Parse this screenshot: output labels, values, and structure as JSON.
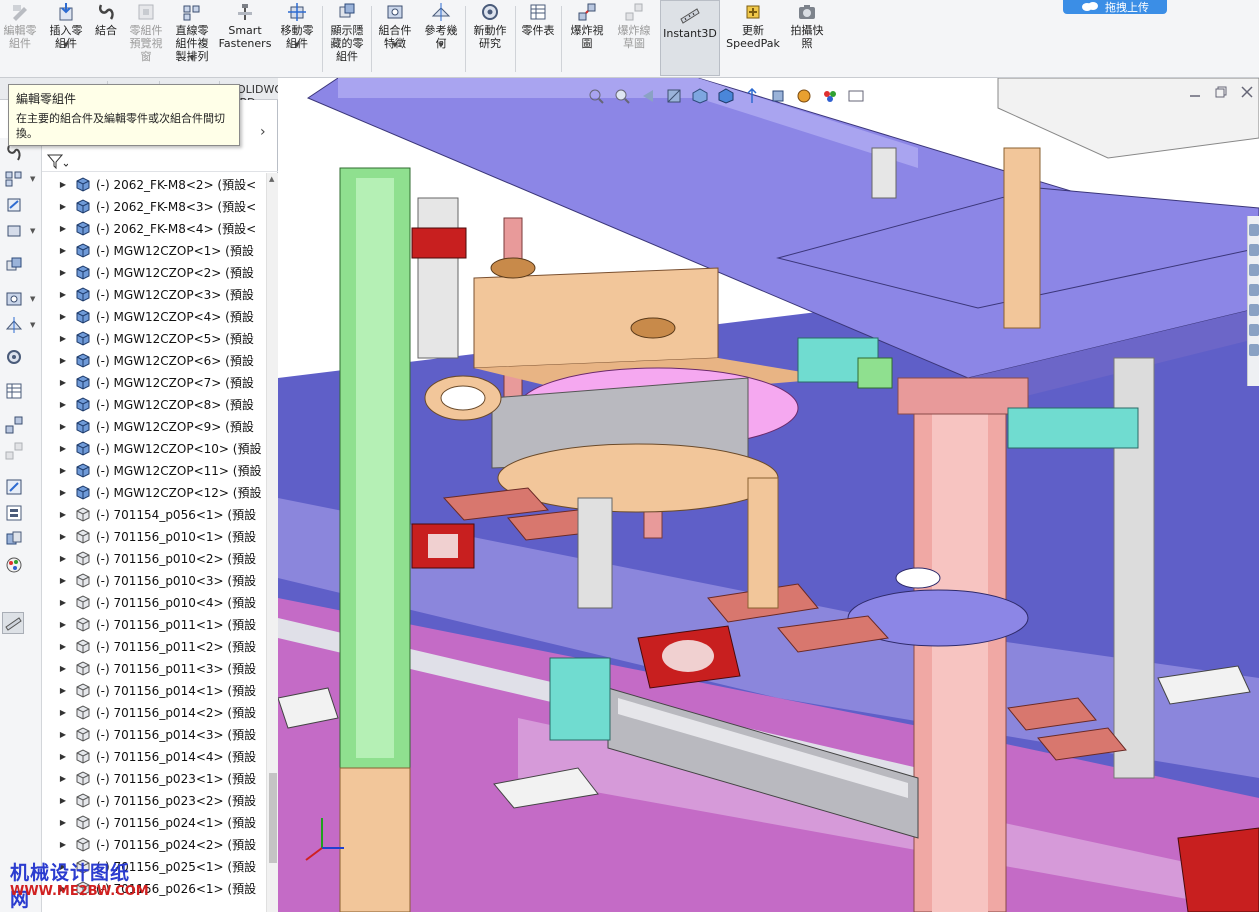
{
  "ribbon": {
    "buttons": [
      {
        "label": "編輯零\n組件",
        "icon": "edit-component-icon",
        "disabled": true
      },
      {
        "label": "插入零\n組件",
        "icon": "insert-component-icon",
        "disabled": false
      },
      {
        "label": "結合",
        "icon": "mate-icon",
        "disabled": false
      },
      {
        "label": "零組件\n預覽視\n窗",
        "icon": "component-preview-icon",
        "disabled": true
      },
      {
        "label": "直線零\n組件複\n製排列",
        "icon": "linear-pattern-icon",
        "disabled": false
      },
      {
        "label": "Smart\nFasteners",
        "icon": "smart-fasteners-icon",
        "disabled": false
      },
      {
        "label": "移動零\n組件",
        "icon": "move-component-icon",
        "disabled": false
      },
      {
        "label": "顯示隱\n藏的零\n組件",
        "icon": "show-hidden-icon",
        "disabled": false
      },
      {
        "label": "組合件\n特徵",
        "icon": "assembly-features-icon",
        "disabled": false
      },
      {
        "label": "參考幾\n何",
        "icon": "reference-geometry-icon",
        "disabled": false
      },
      {
        "label": "新動作\n研究",
        "icon": "motion-study-icon",
        "disabled": false
      },
      {
        "label": "零件表",
        "icon": "bom-icon",
        "disabled": false
      },
      {
        "label": "爆炸視\n圖",
        "icon": "exploded-view-icon",
        "disabled": false
      },
      {
        "label": "爆炸線\n草圖",
        "icon": "explode-line-sketch-icon",
        "disabled": true
      },
      {
        "label": "Instant3D",
        "icon": "instant3d-icon",
        "disabled": false
      },
      {
        "label": "更新\nSpeedPak",
        "icon": "speedpak-icon",
        "disabled": false
      },
      {
        "label": "拍攝快\n照",
        "icon": "snapshot-icon",
        "disabled": false
      }
    ],
    "upload_label": "拖拽上传"
  },
  "tabs": {
    "mbd": "SOLIDWORKS MBD"
  },
  "tooltip": {
    "title": "編輯零組件",
    "description": "在主要的組合件及編輯零件或次組合件間切換。"
  },
  "tree": {
    "items": [
      {
        "label": "(-) 2062_FK-M8<2> (預設<",
        "type": "part-assembly"
      },
      {
        "label": "(-) 2062_FK-M8<3> (預設<",
        "type": "part-assembly"
      },
      {
        "label": "(-) 2062_FK-M8<4> (預設<",
        "type": "part-assembly"
      },
      {
        "label": "(-) MGW12CZOP<1> (預設",
        "type": "part-assembly"
      },
      {
        "label": "(-) MGW12CZOP<2> (預設",
        "type": "part-assembly"
      },
      {
        "label": "(-) MGW12CZOP<3> (預設",
        "type": "part-assembly"
      },
      {
        "label": "(-) MGW12CZOP<4> (預設",
        "type": "part-assembly"
      },
      {
        "label": "(-) MGW12CZOP<5> (預設",
        "type": "part-assembly"
      },
      {
        "label": "(-) MGW12CZOP<6> (預設",
        "type": "part-assembly"
      },
      {
        "label": "(-) MGW12CZOP<7> (預設",
        "type": "part-assembly"
      },
      {
        "label": "(-) MGW12CZOP<8> (預設",
        "type": "part-assembly"
      },
      {
        "label": "(-) MGW12CZOP<9> (預設",
        "type": "part-assembly"
      },
      {
        "label": "(-) MGW12CZOP<10> (預設",
        "type": "part-assembly"
      },
      {
        "label": "(-) MGW12CZOP<11> (預設",
        "type": "part-assembly"
      },
      {
        "label": "(-) MGW12CZOP<12> (預設",
        "type": "part-assembly"
      },
      {
        "label": "(-) 701154_p056<1> (預設",
        "type": "part"
      },
      {
        "label": "(-) 701156_p010<1> (預設",
        "type": "part"
      },
      {
        "label": "(-) 701156_p010<2> (預設",
        "type": "part"
      },
      {
        "label": "(-) 701156_p010<3> (預設",
        "type": "part"
      },
      {
        "label": "(-) 701156_p010<4> (預設",
        "type": "part"
      },
      {
        "label": "(-) 701156_p011<1> (預設",
        "type": "part"
      },
      {
        "label": "(-) 701156_p011<2> (預設",
        "type": "part"
      },
      {
        "label": "(-) 701156_p011<3> (預設",
        "type": "part"
      },
      {
        "label": "(-) 701156_p014<1> (預設",
        "type": "part"
      },
      {
        "label": "(-) 701156_p014<2> (預設",
        "type": "part"
      },
      {
        "label": "(-) 701156_p014<3> (預設",
        "type": "part"
      },
      {
        "label": "(-) 701156_p014<4> (預設",
        "type": "part"
      },
      {
        "label": "(-) 701156_p023<1> (預設",
        "type": "part"
      },
      {
        "label": "(-) 701156_p023<2> (預設",
        "type": "part"
      },
      {
        "label": "(-) 701156_p024<1> (預設",
        "type": "part"
      },
      {
        "label": "(-) 701156_p024<2> (預設",
        "type": "part"
      },
      {
        "label": "(-) 701156_p025<1> (預設",
        "type": "part"
      },
      {
        "label": "(-) 701156_p026<1> (預設",
        "type": "part"
      }
    ]
  },
  "watermark": {
    "line1": "机械设计图纸网",
    "line2": "WWW.ME2BW.COM"
  },
  "colors": {
    "frame_purple": "#8c86e6",
    "floor_blue": "#5c5cc4",
    "column_green": "#8fe08f",
    "column_pink": "#f0a8a4",
    "plate_magenta": "#c879c8",
    "block_salmon": "#d8776e",
    "rod_pink": "#e89a9a",
    "plate_peach": "#f2c69a",
    "fixture_red": "#c81f1f"
  }
}
